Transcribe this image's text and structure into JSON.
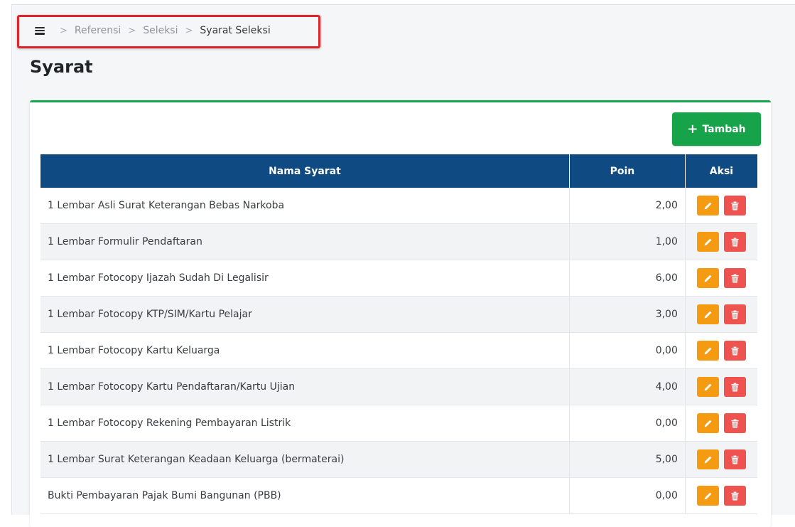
{
  "breadcrumb": {
    "items": [
      "Referensi",
      "Seleksi",
      "Syarat Seleksi"
    ]
  },
  "page": {
    "title": "Syarat"
  },
  "toolbar": {
    "add_label": "Tambah"
  },
  "table": {
    "headers": {
      "name": "Nama Syarat",
      "poin": "Poin",
      "aksi": "Aksi"
    },
    "rows": [
      {
        "name": "1 Lembar Asli Surat Keterangan Bebas Narkoba",
        "poin": "2,00"
      },
      {
        "name": "1 Lembar Formulir Pendaftaran",
        "poin": "1,00"
      },
      {
        "name": "1 Lembar Fotocopy Ijazah Sudah Di Legalisir",
        "poin": "6,00"
      },
      {
        "name": "1 Lembar Fotocopy KTP/SIM/Kartu Pelajar",
        "poin": "3,00"
      },
      {
        "name": "1 Lembar Fotocopy Kartu Keluarga",
        "poin": "0,00"
      },
      {
        "name": "1 Lembar Fotocopy Kartu Pendaftaran/Kartu Ujian",
        "poin": "4,00"
      },
      {
        "name": "1 Lembar Fotocopy Rekening Pembayaran Listrik",
        "poin": "0,00"
      },
      {
        "name": "1 Lembar Surat Keterangan Keadaan Keluarga (bermaterai)",
        "poin": "5,00"
      },
      {
        "name": "Bukti Pembayaran Pajak Bumi Bangunan (PBB)",
        "poin": "0,00"
      }
    ]
  },
  "icons": {
    "menu": "hamburger-menu-icon",
    "add": "plus-icon",
    "edit": "pencil-icon",
    "delete": "trash-icon"
  },
  "colors": {
    "header_bg": "#0f4a82",
    "accent_green": "#16a34a",
    "edit_orange": "#f49b12",
    "delete_red": "#ef5350",
    "highlight_red": "#e0252a"
  }
}
